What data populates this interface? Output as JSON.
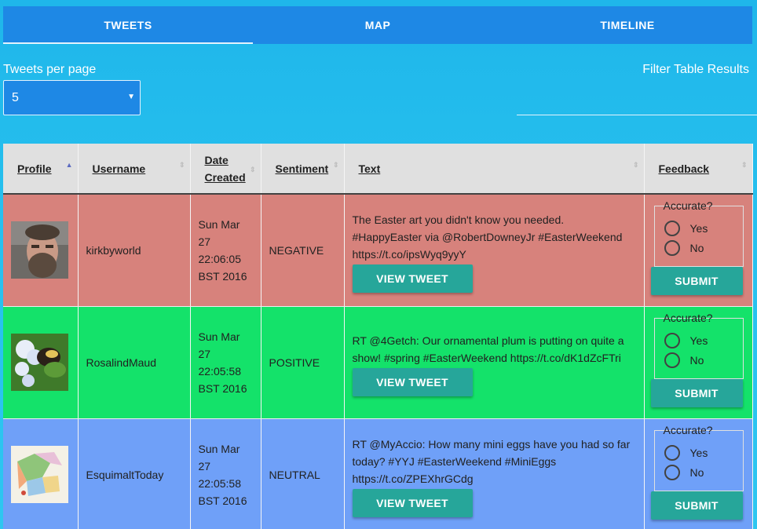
{
  "tabs": [
    {
      "label": "TWEETS",
      "active": true
    },
    {
      "label": "MAP",
      "active": false
    },
    {
      "label": "TIMELINE",
      "active": false
    }
  ],
  "per_page": {
    "label": "Tweets per page",
    "value": "5"
  },
  "filter": {
    "label": "Filter Table Results"
  },
  "table": {
    "headers": {
      "profile": "Profile",
      "username": "Username",
      "date_line1": "Date",
      "date_line2": "Created",
      "sentiment": "Sentiment",
      "text": "Text",
      "feedback": "Feedback"
    },
    "rows": [
      {
        "username": "kirkbyworld",
        "date": [
          "Sun Mar",
          "27",
          "22:06:05",
          "BST 2016"
        ],
        "sentiment": "NEGATIVE",
        "text": "The Easter art you didn't know you needed. #HappyEaster via @RobertDowneyJr #EasterWeekend https://t.co/ipsWyq9yyY",
        "row_color": "#d7827c"
      },
      {
        "username": "RosalindMaud",
        "date": [
          "Sun Mar",
          "27",
          "22:05:58",
          "BST 2016"
        ],
        "sentiment": "POSITIVE",
        "text": "RT @4Getch: Our ornamental plum is putting on quite a show! #spring #EasterWeekend https://t.co/dK1dZcFTri",
        "row_color": "#14e26a"
      },
      {
        "username": "EsquimaltToday",
        "date": [
          "Sun Mar",
          "27",
          "22:05:58",
          "BST 2016"
        ],
        "sentiment": "NEUTRAL",
        "text": "RT @MyAccio: How many mini eggs have you had so far today? #YYJ #EasterWeekend #MiniEggs https://t.co/ZPEXhrGCdg",
        "row_color": "#6fa0f8"
      }
    ],
    "view_tweet_label": "VIEW TWEET",
    "feedback": {
      "legend": "Accurate?",
      "yes_label": "Yes",
      "no_label": "No",
      "submit_label": "SUBMIT"
    }
  },
  "colors": {
    "tab_bar": "#1e88e5",
    "accent_button": "#26a69a",
    "negative": "#d7827c",
    "positive": "#14e26a",
    "neutral": "#6fa0f8"
  }
}
